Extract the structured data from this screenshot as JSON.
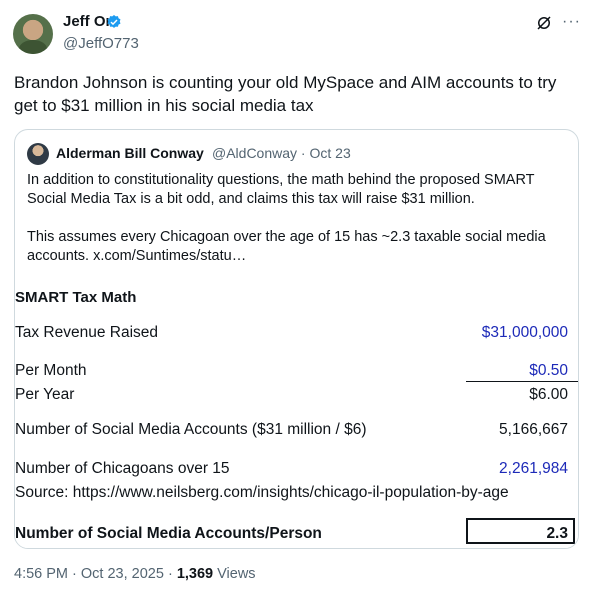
{
  "author": {
    "name": "Jeff Orr",
    "handle": "@JeffO773"
  },
  "tweet": {
    "text": "Brandon Johnson is counting your old MySpace and AIM accounts to try get to $31 million in his social media tax"
  },
  "quote": {
    "name": "Alderman Bill Conway",
    "handle": "@AldConway",
    "separator": "·",
    "date": "Oct 23",
    "para1": "In addition to constitutionality questions, the math behind the proposed SMART Social Media Tax is a bit odd, and claims this tax will raise $31 million.",
    "para2": "This assumes every Chicagoan over the age of 15 has ~2.3 taxable social media accounts.  x.com/Suntimes/statu…"
  },
  "sheet": {
    "title": "SMART Tax Math",
    "revenue_label": "Tax Revenue Raised",
    "revenue_value": "$31,000,000",
    "per_month_label": "Per Month",
    "per_month_value": "$0.50",
    "per_year_label": "Per Year",
    "per_year_value": "$6.00",
    "accounts_label": "Number of Social Media Accounts ($31 million / $6)",
    "accounts_value": "5,166,667",
    "chicagoans_label": "Number of Chicagoans over 15",
    "chicagoans_value": "2,261,984",
    "source": "Source: https://www.neilsberg.com/insights/chicago-il-population-by-age",
    "per_person_label": "Number of Social Media Accounts/Person",
    "per_person_value": "2.3"
  },
  "footer": {
    "time": "4:56 PM · Oct 23, 2025 · ",
    "views_count": "1,369",
    "views_label": " Views"
  },
  "colors": {
    "link_blue": "#1d2ab8",
    "verified": "#1d9bf0",
    "muted": "#536471"
  }
}
